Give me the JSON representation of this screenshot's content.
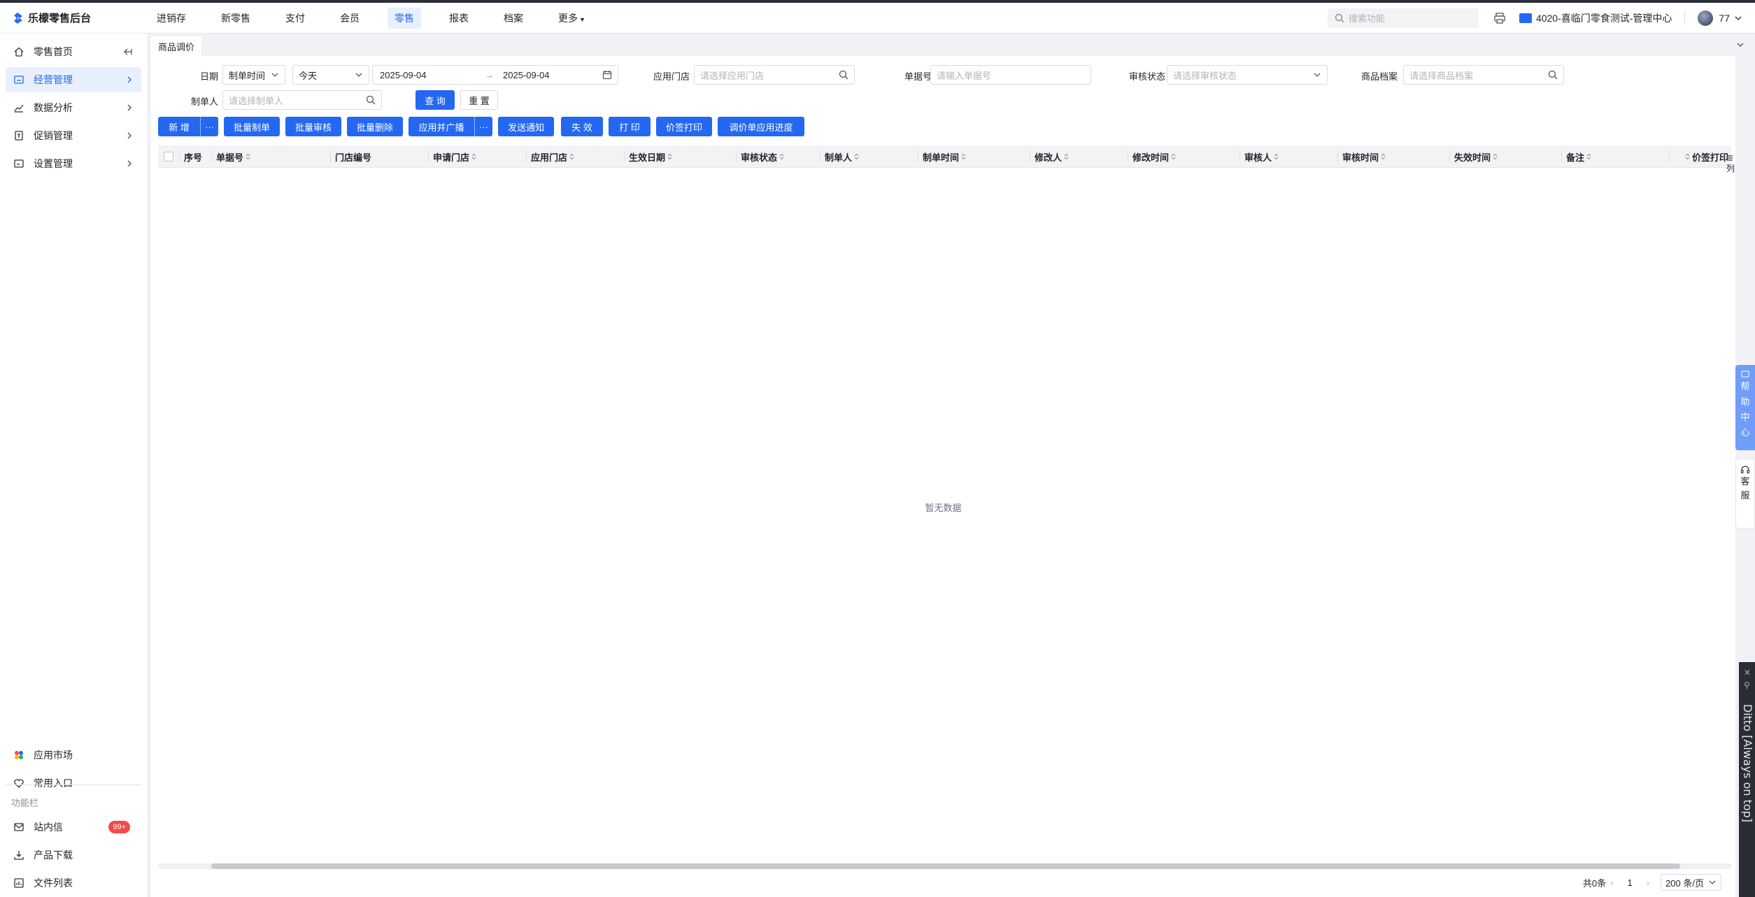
{
  "app": {
    "title": "乐檬零售后台",
    "brand_color": "#2468f2"
  },
  "topnav": {
    "items": [
      {
        "label": "进销存",
        "active": false
      },
      {
        "label": "新零售",
        "active": false
      },
      {
        "label": "支付",
        "active": false
      },
      {
        "label": "会员",
        "active": false
      },
      {
        "label": "零售",
        "active": true
      },
      {
        "label": "报表",
        "active": false
      },
      {
        "label": "档案",
        "active": false
      },
      {
        "label": "更多",
        "active": false
      }
    ],
    "search_placeholder": "搜索功能",
    "store": "4020-喜临门零食测试-管理中心",
    "user": "77"
  },
  "sidebar": {
    "items": [
      {
        "label": "零售首页",
        "icon": "home-icon"
      },
      {
        "label": "经营管理",
        "icon": "dashboard-icon",
        "active": true
      },
      {
        "label": "数据分析",
        "icon": "chart-icon"
      },
      {
        "label": "促销管理",
        "icon": "promo-icon"
      },
      {
        "label": "设置管理",
        "icon": "settings-icon"
      }
    ],
    "bottom_items": [
      {
        "label": "应用市场",
        "icon": "app-market-icon"
      },
      {
        "label": "常用入口",
        "icon": "heart-icon"
      }
    ],
    "section_label": "功能栏",
    "func_items": [
      {
        "label": "站内信",
        "icon": "mail-icon",
        "badge": "99+"
      },
      {
        "label": "产品下载",
        "icon": "download-icon"
      },
      {
        "label": "文件列表",
        "icon": "file-list-icon"
      }
    ]
  },
  "tabs": {
    "current": "商品调价"
  },
  "filters": {
    "date_label": "日期",
    "date_type": "制单时间",
    "date_range_preset": "今天",
    "date_start": "2025-09-04",
    "date_sep": "→",
    "date_end": "2025-09-04",
    "store_label": "应用门店",
    "store_placeholder": "请选择应用门店",
    "order_label": "单据号",
    "order_placeholder": "请输入单据号",
    "audit_label": "审核状态",
    "audit_placeholder": "请选择审核状态",
    "goods_label": "商品档案",
    "goods_placeholder": "请选择商品档案",
    "maker_label": "制单人",
    "maker_placeholder": "请选择制单人",
    "query_btn": "查 询",
    "reset_btn": "重 置"
  },
  "toolbar": {
    "new": "新 增",
    "more": "···",
    "batch_make": "批量制单",
    "batch_audit": "批量审核",
    "batch_delete": "批量删除",
    "apply_broadcast": "应用并广播",
    "send_notice": "发送通知",
    "invalidate": "失 效",
    "print": "打 印",
    "price_tag_print": "价签打印",
    "apply_progress": "调价单应用进度"
  },
  "table": {
    "columns": [
      "序号",
      "单据号",
      "门店编号",
      "申请门店",
      "应用门店",
      "生效日期",
      "审核状态",
      "制单人",
      "制单时间",
      "修改人",
      "修改时间",
      "审核人",
      "审核时间",
      "失效时间",
      "备注",
      "价签打印"
    ],
    "column_toggle": "列",
    "empty_text": "暂无数据"
  },
  "pagination": {
    "total": "共0条",
    "page": "1",
    "page_size": "200 条/页"
  },
  "floating": {
    "help": [
      "帮",
      "助",
      "中",
      "心"
    ],
    "service": [
      "客",
      "服"
    ],
    "ditto": "Ditto [Always on top]"
  }
}
